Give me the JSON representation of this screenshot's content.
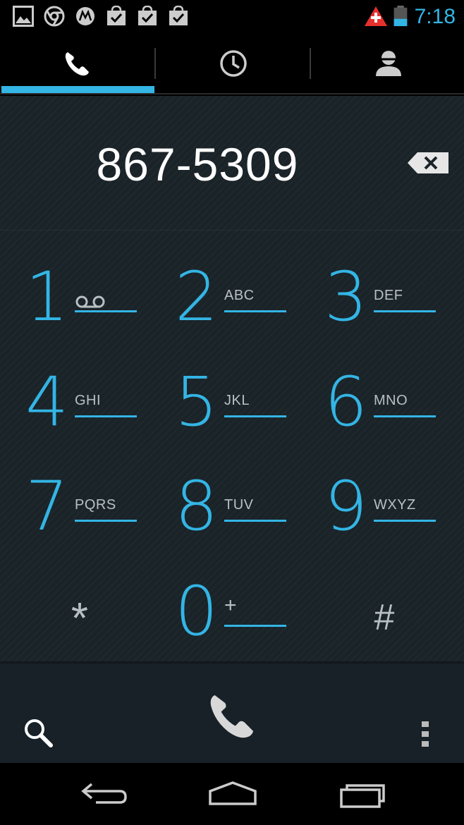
{
  "status_bar": {
    "icons": [
      "gallery-notification-icon",
      "chrome-notification-icon",
      "motorola-notification-icon",
      "market-check-icon",
      "market-check-icon",
      "market-check-icon",
      "alert-icon",
      "battery-icon"
    ],
    "time": "7:18"
  },
  "tabs": [
    {
      "icon": "phone-icon",
      "selected": true
    },
    {
      "icon": "call-log-clock-icon",
      "selected": false
    },
    {
      "icon": "contacts-person-icon",
      "selected": false
    }
  ],
  "dialer": {
    "number": "867-5309",
    "backspace_icon": "backspace-icon"
  },
  "keypad": [
    {
      "digit": "1",
      "letters": ""
    },
    {
      "digit": "2",
      "letters": "ABC"
    },
    {
      "digit": "3",
      "letters": "DEF"
    },
    {
      "digit": "4",
      "letters": "GHI"
    },
    {
      "digit": "5",
      "letters": "JKL"
    },
    {
      "digit": "6",
      "letters": "MNO"
    },
    {
      "digit": "7",
      "letters": "PQRS"
    },
    {
      "digit": "8",
      "letters": "TUV"
    },
    {
      "digit": "9",
      "letters": "WXYZ"
    },
    {
      "digit": "*",
      "letters": ""
    },
    {
      "digit": "0",
      "letters": "+"
    },
    {
      "digit": "#",
      "letters": ""
    }
  ],
  "action_bar": {
    "icons": [
      "search-icon",
      "call-icon",
      "overflow-menu-icon"
    ]
  },
  "nav_bar": {
    "icons": [
      "back-icon",
      "home-icon",
      "recents-icon"
    ]
  },
  "colors": {
    "accent": "#33b5e5",
    "background": "#1a2328",
    "text_secondary": "#b9c0c4"
  }
}
